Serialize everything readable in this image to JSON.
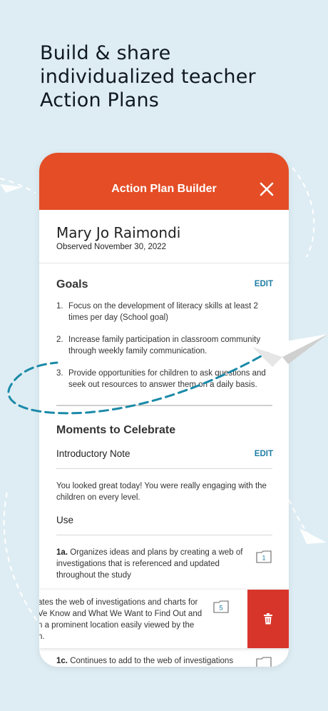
{
  "headline": {
    "line1": "Build & share",
    "line2": "individualized teacher",
    "line3": "Action Plans"
  },
  "app": {
    "title": "Action Plan Builder",
    "accent_color": "#e44d26",
    "link_color": "#1f7ea5",
    "delete_color": "#d8352a"
  },
  "profile": {
    "name": "Mary Jo Raimondi",
    "observed": "Observed November 30, 2022"
  },
  "goals": {
    "heading": "Goals",
    "edit_label": "EDIT",
    "items": [
      {
        "num": "1.",
        "text": "Focus on the development of literacy skills at least 2 times per day (School goal)"
      },
      {
        "num": "2.",
        "text": "Increase family participation in classroom community through weekly family communication."
      },
      {
        "num": "3.",
        "text": "Provide opportunities for children to ask questions and seek out resources to answer them on a daily basis."
      }
    ]
  },
  "moments": {
    "heading": "Moments to Celebrate",
    "intro_label": "Introductory Note",
    "edit_label": "EDIT",
    "intro_text": "You looked great today! You were really engaging with the children on every level.",
    "use_label": "Use",
    "items": [
      {
        "code": "1a.",
        "text": "Organizes ideas and plans by creating a web of investigations that is referenced and updated throughout the study",
        "count": "1"
      },
      {
        "code": "",
        "text": "ates the web of investigations and charts for Ve Know and What We Want to Find Out and n a prominent location easily viewed by the n.",
        "count": "5"
      },
      {
        "code": "1c.",
        "text": "Continues to add to the web of investigations",
        "count": ""
      }
    ]
  }
}
